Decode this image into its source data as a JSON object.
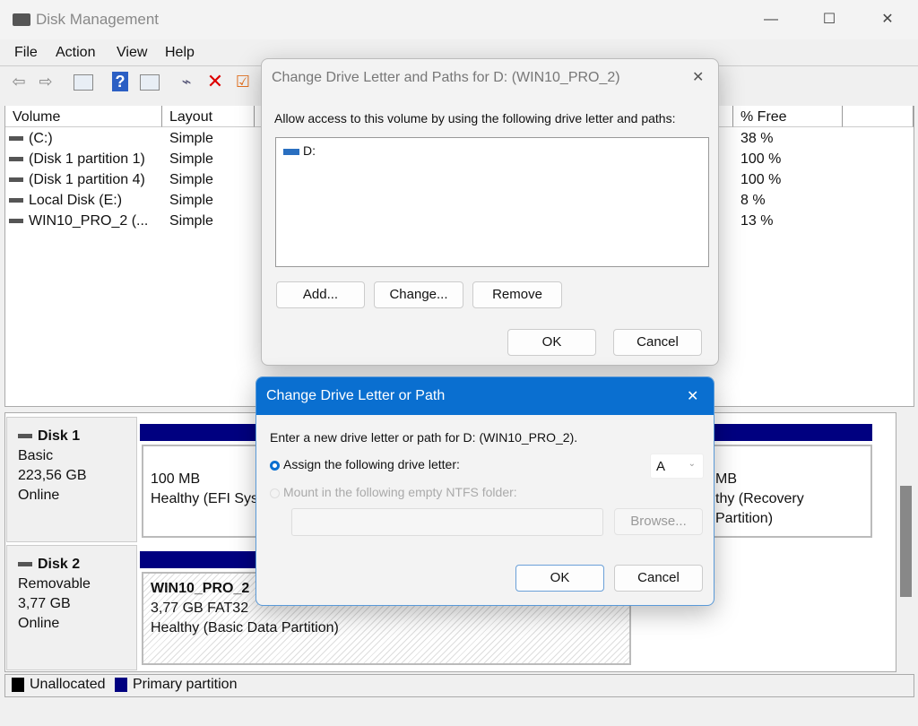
{
  "window": {
    "title": "Disk Management",
    "minimize": "—",
    "maximize": "☐",
    "close": "✕"
  },
  "menu": [
    "File",
    "Action",
    "View",
    "Help"
  ],
  "toolbar": {
    "icons": [
      "back-icon",
      "forward-icon",
      "console-tree-icon",
      "help-icon",
      "action-pane-icon",
      "connect-disk-icon",
      "delete-icon",
      "properties-icon"
    ]
  },
  "volume_list": {
    "columns": [
      "Volume",
      "Layout",
      "% Free"
    ],
    "rows": [
      {
        "volume": "(C:)",
        "layout": "Simple",
        "free": "38 %"
      },
      {
        "volume": "(Disk 1 partition 1)",
        "layout": "Simple",
        "free": "100 %"
      },
      {
        "volume": "(Disk 1 partition 4)",
        "layout": "Simple",
        "free": "100 %"
      },
      {
        "volume": "Local Disk (E:)",
        "layout": "Simple",
        "free": "8 %"
      },
      {
        "volume": "WIN10_PRO_2 (...",
        "layout": "Simple",
        "free": "13 %"
      }
    ]
  },
  "disks": [
    {
      "name": "Disk 1",
      "type": "Basic",
      "size": "223,56 GB",
      "status": "Online",
      "partitions": [
        {
          "size": "100 MB",
          "status": "Healthy (EFI Syst"
        },
        {
          "size": "MB",
          "status": "thy (Recovery Partition)"
        }
      ]
    },
    {
      "name": "Disk 2",
      "type": "Removable",
      "size": "3,77 GB",
      "status": "Online",
      "partitions": [
        {
          "name": "WIN10_PRO_2",
          "size": "3,77 GB FAT32",
          "status": "Healthy (Basic Data Partition)"
        }
      ]
    }
  ],
  "legend": [
    {
      "label": "Unallocated",
      "color": "#000000"
    },
    {
      "label": "Primary partition",
      "color": "#000080"
    }
  ],
  "dialog1": {
    "title": "Change Drive Letter and Paths for D: (WIN10_PRO_2)",
    "close": "✕",
    "prompt": "Allow access to this volume by using the following drive letter and paths:",
    "items": [
      "D:"
    ],
    "add": "Add...",
    "change": "Change...",
    "remove": "Remove",
    "ok": "OK",
    "cancel": "Cancel"
  },
  "dialog2": {
    "title": "Change Drive Letter or Path",
    "close": "✕",
    "prompt": "Enter a new drive letter or path for D: (WIN10_PRO_2).",
    "assign_label": "Assign the following drive letter:",
    "assign_selected": true,
    "letter": "A",
    "mount_label": "Mount in the following empty NTFS folder:",
    "folder_value": "",
    "browse": "Browse...",
    "ok": "OK",
    "cancel": "Cancel",
    "accent": "#0a6fd0"
  }
}
